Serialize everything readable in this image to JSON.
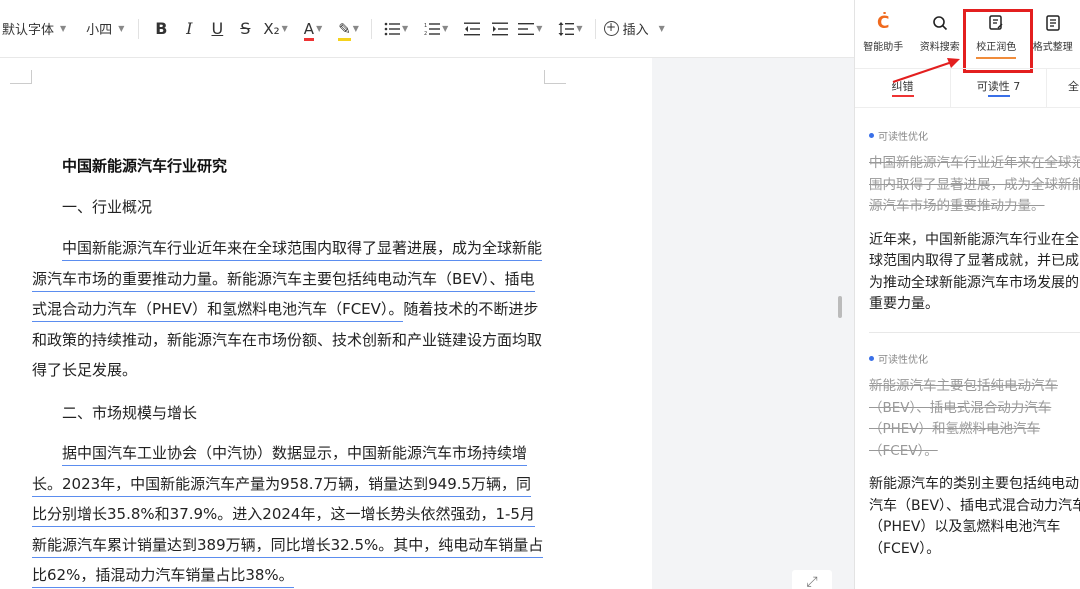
{
  "toolbar": {
    "font_family": "默认字体",
    "font_size": "小四",
    "bold": "B",
    "italic": "I",
    "underline": "U",
    "strike": "S",
    "subscript": "X₂",
    "font_color": "A",
    "highlight": "✎",
    "insert_label": "插入"
  },
  "document": {
    "title": "中国新能源汽车行业研究",
    "heading1": "一、行业概况",
    "para1": "中国新能源汽车行业近年来在全球范围内取得了显著进展，成为全球新能源汽车市场的重要推动力量。新能源汽车主要包括纯电动汽车（BEV）、插电式混合动力汽车（PHEV）和氢燃料电池汽车（FCEV）。随着技术的不断进步和政策的持续推动，新能源汽车在市场份额、技术创新和产业链建设方面均取得了长足发展。",
    "para1_underlined": "中国新能源汽车行业近年来在全球范围内取得了显著进展，成为全球新能源汽车市场的重要推动力量。新能源汽车主要包括纯电动汽车（BEV）、插电式混合动力汽车（PHEV）和氢燃料电池汽车（FCEV）。",
    "para1_rest": "随着技术的不断进步和政策的持续推动，新能源汽车在市场份额、技术创新和产业链建设方面均取得了长足发展。",
    "heading2": "二、市场规模与增长",
    "para2": "据中国汽车工业协会（中汽协）数据显示，中国新能源汽车市场持续增长。2023年，中国新能源汽车产量为958.7万辆，销量达到949.5万辆，同比分别增长35.8%和37.9%。进入2024年，这一增长势头依然强劲，1-5月新能源汽车累计销量达到389万辆，同比增长32.5%。其中，纯电动车销量占比62%，插混动力汽车销量占比38%。"
  },
  "panel": {
    "tabs": [
      {
        "label": "智能助手",
        "icon": "assistant-icon"
      },
      {
        "label": "资料搜索",
        "icon": "search-icon"
      },
      {
        "label": "校正润色",
        "icon": "proofread-icon"
      },
      {
        "label": "格式整理",
        "icon": "format-icon"
      }
    ],
    "sub_tabs": [
      {
        "label": "纠错",
        "color": "#e33"
      },
      {
        "label": "可读性 7",
        "color": "#3a70e8"
      }
    ],
    "sub_more": "全",
    "suggestions": [
      {
        "tag": "可读性优化",
        "old": "中国新能源汽车行业近年来在全球范围内取得了显著进展，成为全球新能源汽车市场的重要推动力量。",
        "new": "近年来，中国新能源汽车行业在全球范围内取得了显著成就，并已成为推动全球新能源汽车市场发展的重要力量。"
      },
      {
        "tag": "可读性优化",
        "old": "新能源汽车主要包括纯电动汽车（BEV）、插电式混合动力汽车（PHEV）和氢燃料电池汽车（FCEV）。",
        "new": "新能源汽车的类别主要包括纯电动汽车（BEV）、插电式混合动力汽车（PHEV）以及氢燃料电池汽车（FCEV）。"
      }
    ]
  },
  "colors": {
    "annotation_red": "#e31f1f",
    "underline_blue": "#5b8def",
    "active_orange": "#f08c3b"
  }
}
